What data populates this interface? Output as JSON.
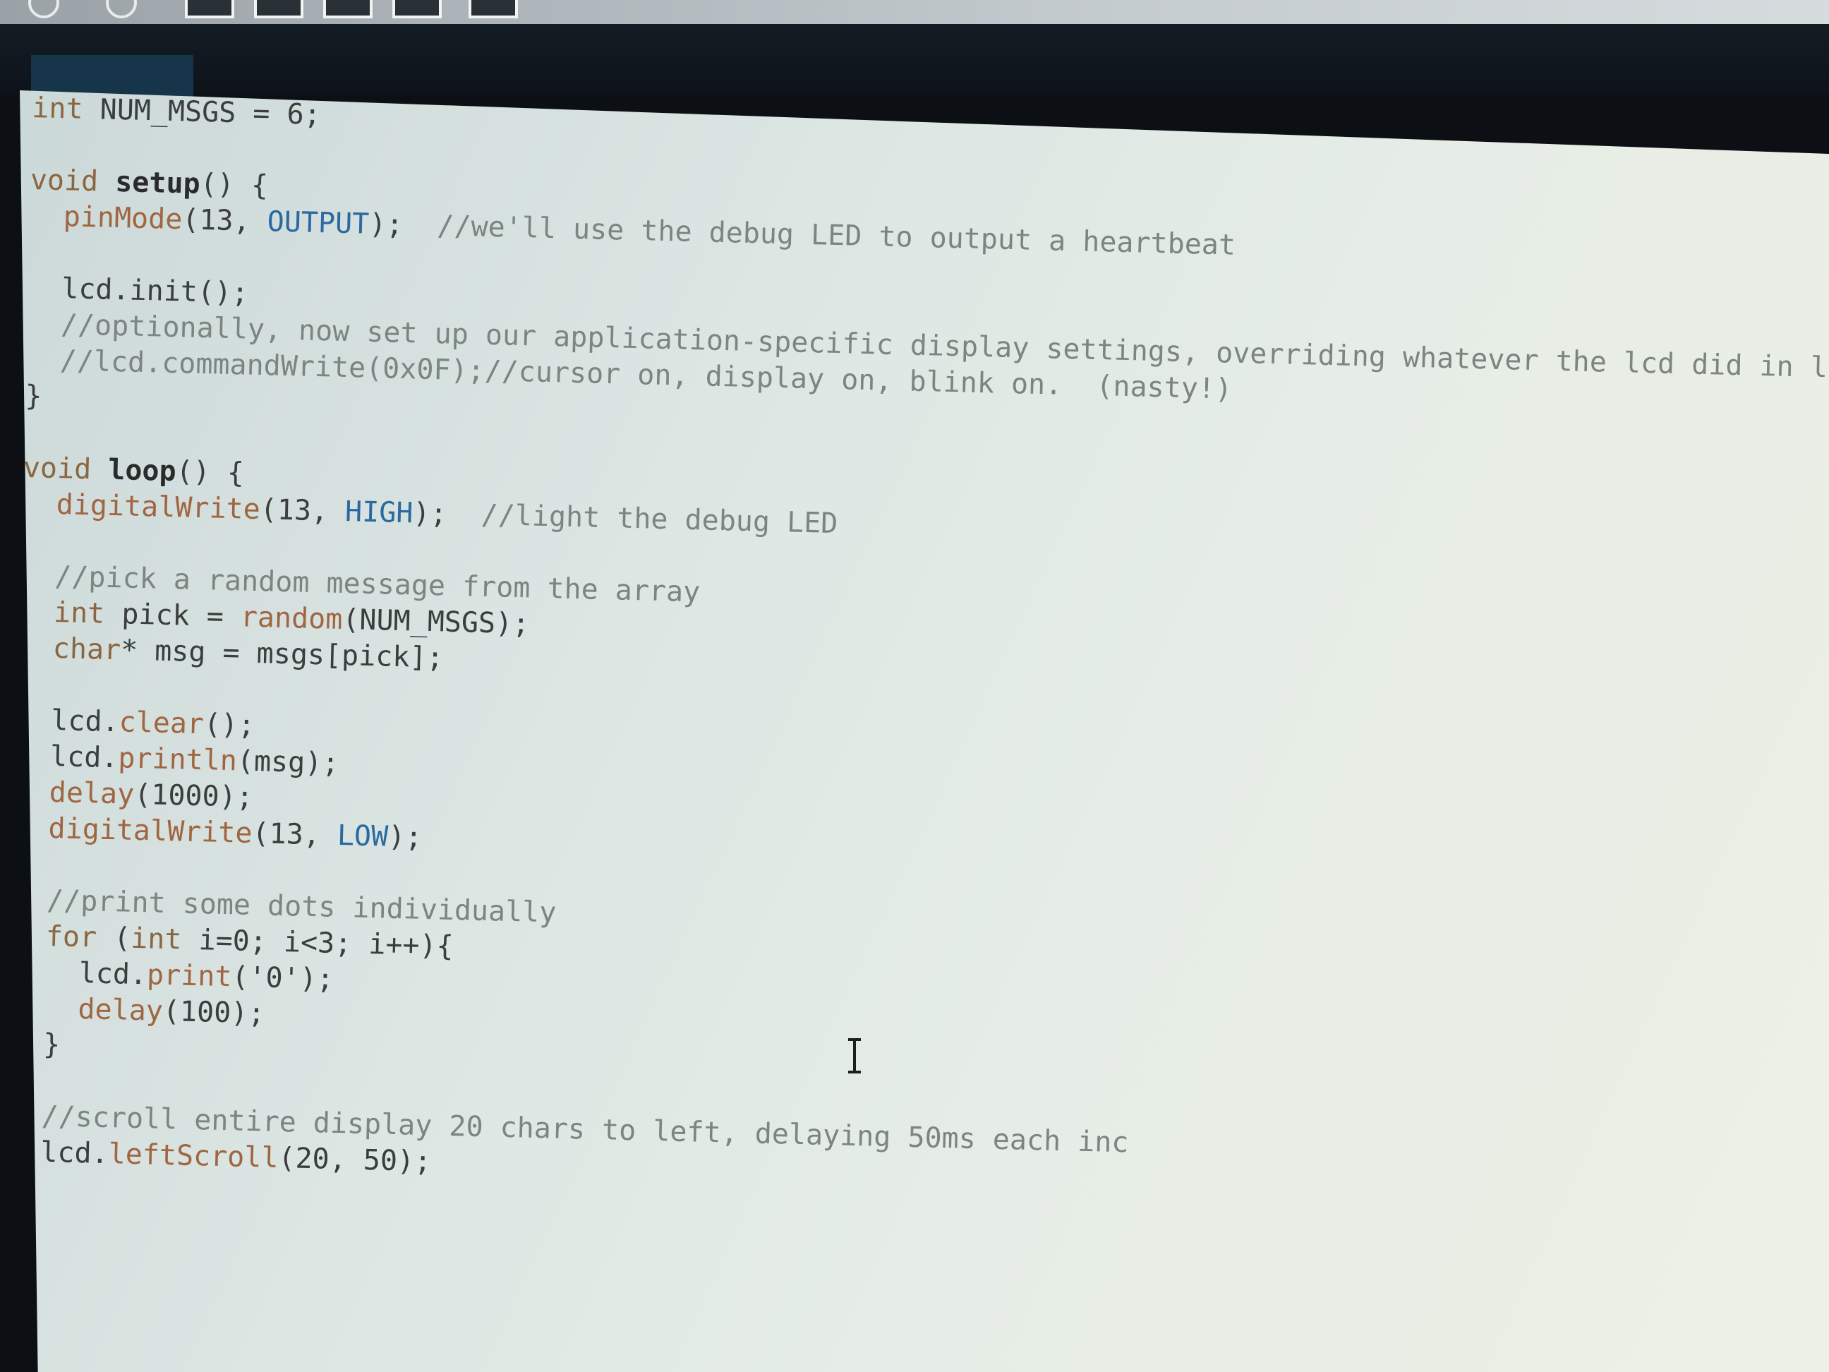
{
  "editor": {
    "tab_label": "",
    "lines": [
      [
        {
          "t": "int",
          "c": "kw"
        },
        {
          "t": " NUM_MSGS = 6;",
          "c": "plain"
        }
      ],
      [],
      [
        {
          "t": "void",
          "c": "kw"
        },
        {
          "t": " ",
          "c": "plain"
        },
        {
          "t": "setup",
          "c": "fnb"
        },
        {
          "t": "() {",
          "c": "plain"
        }
      ],
      [
        {
          "t": "  ",
          "c": "plain"
        },
        {
          "t": "pinMode",
          "c": "fn"
        },
        {
          "t": "(13, ",
          "c": "plain"
        },
        {
          "t": "OUTPUT",
          "c": "const"
        },
        {
          "t": ");  ",
          "c": "plain"
        },
        {
          "t": "//we'll use the debug LED to output a heartbeat",
          "c": "cm"
        }
      ],
      [],
      [
        {
          "t": "  lcd.init();",
          "c": "plain"
        }
      ],
      [
        {
          "t": "  ",
          "c": "plain"
        },
        {
          "t": "//optionally, now set up our application-specific display settings, overriding whatever the lcd did in lcd.i",
          "c": "cm"
        }
      ],
      [
        {
          "t": "  ",
          "c": "plain"
        },
        {
          "t": "//lcd.commandWrite(0x0F);//cursor on, display on, blink on.  (nasty!)",
          "c": "cm"
        }
      ],
      [
        {
          "t": "}",
          "c": "plain"
        }
      ],
      [],
      [
        {
          "t": "void",
          "c": "kw"
        },
        {
          "t": " ",
          "c": "plain"
        },
        {
          "t": "loop",
          "c": "fnb"
        },
        {
          "t": "() {",
          "c": "plain"
        }
      ],
      [
        {
          "t": "  ",
          "c": "plain"
        },
        {
          "t": "digitalWrite",
          "c": "fn"
        },
        {
          "t": "(13, ",
          "c": "plain"
        },
        {
          "t": "HIGH",
          "c": "const"
        },
        {
          "t": ");  ",
          "c": "plain"
        },
        {
          "t": "//light the debug LED",
          "c": "cm"
        }
      ],
      [],
      [
        {
          "t": "  ",
          "c": "plain"
        },
        {
          "t": "//pick a random message from the array",
          "c": "cm"
        }
      ],
      [
        {
          "t": "  ",
          "c": "plain"
        },
        {
          "t": "int",
          "c": "kw"
        },
        {
          "t": " pick = ",
          "c": "plain"
        },
        {
          "t": "random",
          "c": "fn"
        },
        {
          "t": "(NUM_MSGS);",
          "c": "plain"
        }
      ],
      [
        {
          "t": "  ",
          "c": "plain"
        },
        {
          "t": "char",
          "c": "kw"
        },
        {
          "t": "* msg = msgs[pick];",
          "c": "plain"
        }
      ],
      [],
      [
        {
          "t": "  lcd.",
          "c": "plain"
        },
        {
          "t": "clear",
          "c": "fn"
        },
        {
          "t": "();",
          "c": "plain"
        }
      ],
      [
        {
          "t": "  lcd.",
          "c": "plain"
        },
        {
          "t": "println",
          "c": "fn"
        },
        {
          "t": "(msg);",
          "c": "plain"
        }
      ],
      [
        {
          "t": "  ",
          "c": "plain"
        },
        {
          "t": "delay",
          "c": "fn"
        },
        {
          "t": "(1000);",
          "c": "plain"
        }
      ],
      [
        {
          "t": "  ",
          "c": "plain"
        },
        {
          "t": "digitalWrite",
          "c": "fn"
        },
        {
          "t": "(13, ",
          "c": "plain"
        },
        {
          "t": "LOW",
          "c": "const"
        },
        {
          "t": ");",
          "c": "plain"
        }
      ],
      [],
      [
        {
          "t": "  ",
          "c": "plain"
        },
        {
          "t": "//print some dots individually",
          "c": "cm"
        }
      ],
      [
        {
          "t": "  ",
          "c": "plain"
        },
        {
          "t": "for",
          "c": "kw"
        },
        {
          "t": " (",
          "c": "plain"
        },
        {
          "t": "int",
          "c": "kw"
        },
        {
          "t": " i=0; i<3; i++){",
          "c": "plain"
        }
      ],
      [
        {
          "t": "    lcd.",
          "c": "plain"
        },
        {
          "t": "print",
          "c": "fn"
        },
        {
          "t": "('0');",
          "c": "plain"
        }
      ],
      [
        {
          "t": "    ",
          "c": "plain"
        },
        {
          "t": "delay",
          "c": "fn"
        },
        {
          "t": "(100);",
          "c": "plain"
        }
      ],
      [
        {
          "t": "  }",
          "c": "plain"
        }
      ],
      [],
      [
        {
          "t": "  ",
          "c": "plain"
        },
        {
          "t": "//scroll entire display 20 chars to left, delaying 50ms each inc",
          "c": "cm"
        }
      ],
      [
        {
          "t": "  lcd.",
          "c": "plain"
        },
        {
          "t": "leftScroll",
          "c": "fn"
        },
        {
          "t": "(20, 50);",
          "c": "plain"
        }
      ],
      [
        {
          "t": "}",
          "c": "plain"
        }
      ]
    ]
  },
  "colors": {
    "keyword": "#8c6640",
    "function": "#a06642",
    "comment": "#7d8580",
    "constant": "#2b6aa0",
    "text": "#3a3e3c",
    "editor_bg": "#dce6e3"
  },
  "icons": {
    "mouse_cursor": "text-ibeam-cursor-icon"
  }
}
